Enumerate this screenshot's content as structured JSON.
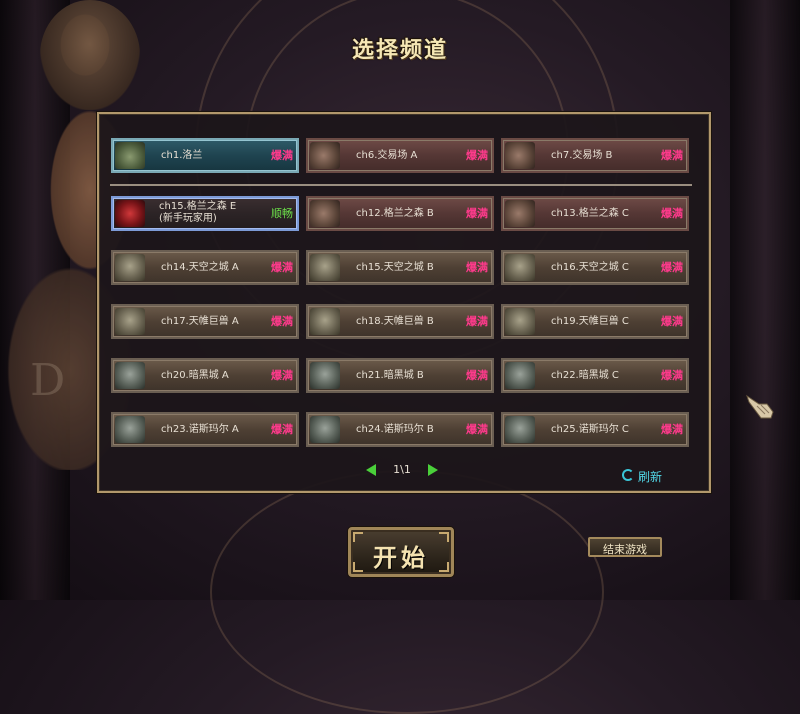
{
  "title": "选择频道",
  "channels_top": [
    {
      "name": "ch1.洛兰",
      "status": "爆满",
      "thumb": "g",
      "style": "teal"
    },
    {
      "name": "ch6.交易场 A",
      "status": "爆满",
      "thumb": "m",
      "style": "red"
    },
    {
      "name": "ch7.交易场 B",
      "status": "爆满",
      "thumb": "m",
      "style": "red"
    }
  ],
  "channels": [
    {
      "name": "ch15.格兰之森 E",
      "name_line2": "(新手玩家用)",
      "status": "顺畅",
      "thumb": "r",
      "style": "sel"
    },
    {
      "name": "ch12.格兰之森 B",
      "status": "爆满",
      "thumb": "m",
      "style": "red"
    },
    {
      "name": "ch13.格兰之森 C",
      "status": "爆满",
      "thumb": "m",
      "style": "red"
    },
    {
      "name": "ch14.天空之城 A",
      "status": "爆满",
      "thumb": "s",
      "style": "plain"
    },
    {
      "name": "ch15.天空之城 B",
      "status": "爆满",
      "thumb": "s",
      "style": "plain"
    },
    {
      "name": "ch16.天空之城 C",
      "status": "爆满",
      "thumb": "s",
      "style": "plain"
    },
    {
      "name": "ch17.天帷巨兽 A",
      "status": "爆满",
      "thumb": "s",
      "style": "plain"
    },
    {
      "name": "ch18.天帷巨兽 B",
      "status": "爆满",
      "thumb": "s",
      "style": "plain"
    },
    {
      "name": "ch19.天帷巨兽 C",
      "status": "爆满",
      "thumb": "s",
      "style": "plain"
    },
    {
      "name": "ch20.暗黑城 A",
      "status": "爆满",
      "thumb": "d",
      "style": "plain"
    },
    {
      "name": "ch21.暗黑城 B",
      "status": "爆满",
      "thumb": "d",
      "style": "plain"
    },
    {
      "name": "ch22.暗黑城 C",
      "status": "爆满",
      "thumb": "d",
      "style": "plain"
    },
    {
      "name": "ch23.诺斯玛尔 A",
      "status": "爆满",
      "thumb": "d",
      "style": "plain"
    },
    {
      "name": "ch24.诺斯玛尔 B",
      "status": "爆满",
      "thumb": "d",
      "style": "plain"
    },
    {
      "name": "ch25.诺斯玛尔 C",
      "status": "爆满",
      "thumb": "d",
      "style": "plain"
    }
  ],
  "pager": {
    "text": "1\\1",
    "prev_icon": "left-arrow-icon",
    "next_icon": "right-arrow-icon"
  },
  "refresh": {
    "label": "刷新",
    "icon": "refresh-icon"
  },
  "start_button": "开始",
  "exit_button": "结束游戏",
  "colors": {
    "status_full": "#ff3a8c",
    "status_smooth": "#6ce04a",
    "accent_green": "#4ad03a",
    "refresh_cyan": "#52d8e8",
    "frame_gold": "#b2986c"
  }
}
